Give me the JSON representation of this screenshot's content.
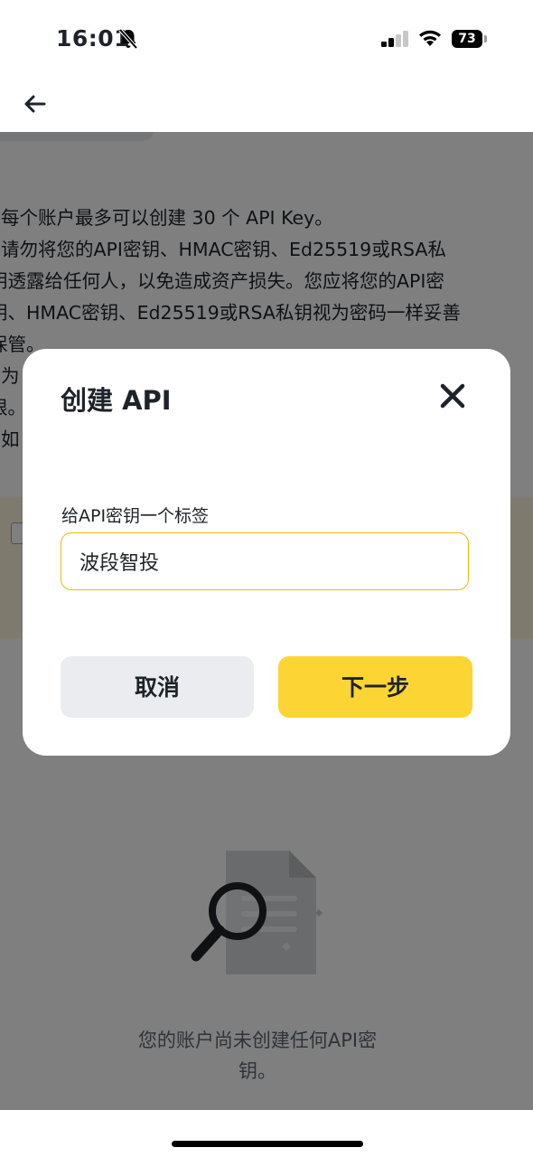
{
  "status_bar": {
    "time": "16:01",
    "battery": "73",
    "icons": [
      "bell-slash-icon",
      "signal-icon",
      "wifi-icon",
      "battery-icon"
    ]
  },
  "header": {
    "back_icon": "arrow-left-icon"
  },
  "notes": [
    ". 每个账户最多可以创建 30 个 API Key。",
    ". 请勿将您的API密钥、HMAC密钥、Ed25519或RSA私",
    "钥透露给任何人，以免造成资产损失。您应将您的API密",
    "钥、HMAC密钥、Ed25519或RSA私钥视为密码一样妥善",
    "保管。",
    ". 为",
    "限。",
    ". 如"
  ],
  "empty_state": {
    "text_line1": "您的账户尚未创建任何API密",
    "text_line2": "钥。",
    "illustration": "search-document-icon"
  },
  "modal": {
    "title": "创建 API",
    "close_icon": "close-icon",
    "field_label": "给API密钥一个标签",
    "input_value": "波段智投",
    "cancel_label": "取消",
    "next_label": "下一步"
  },
  "colors": {
    "accent": "#FCD535",
    "input_border": "#F0B90B",
    "cancel_bg": "#EAECEF",
    "text": "#1E2329"
  }
}
